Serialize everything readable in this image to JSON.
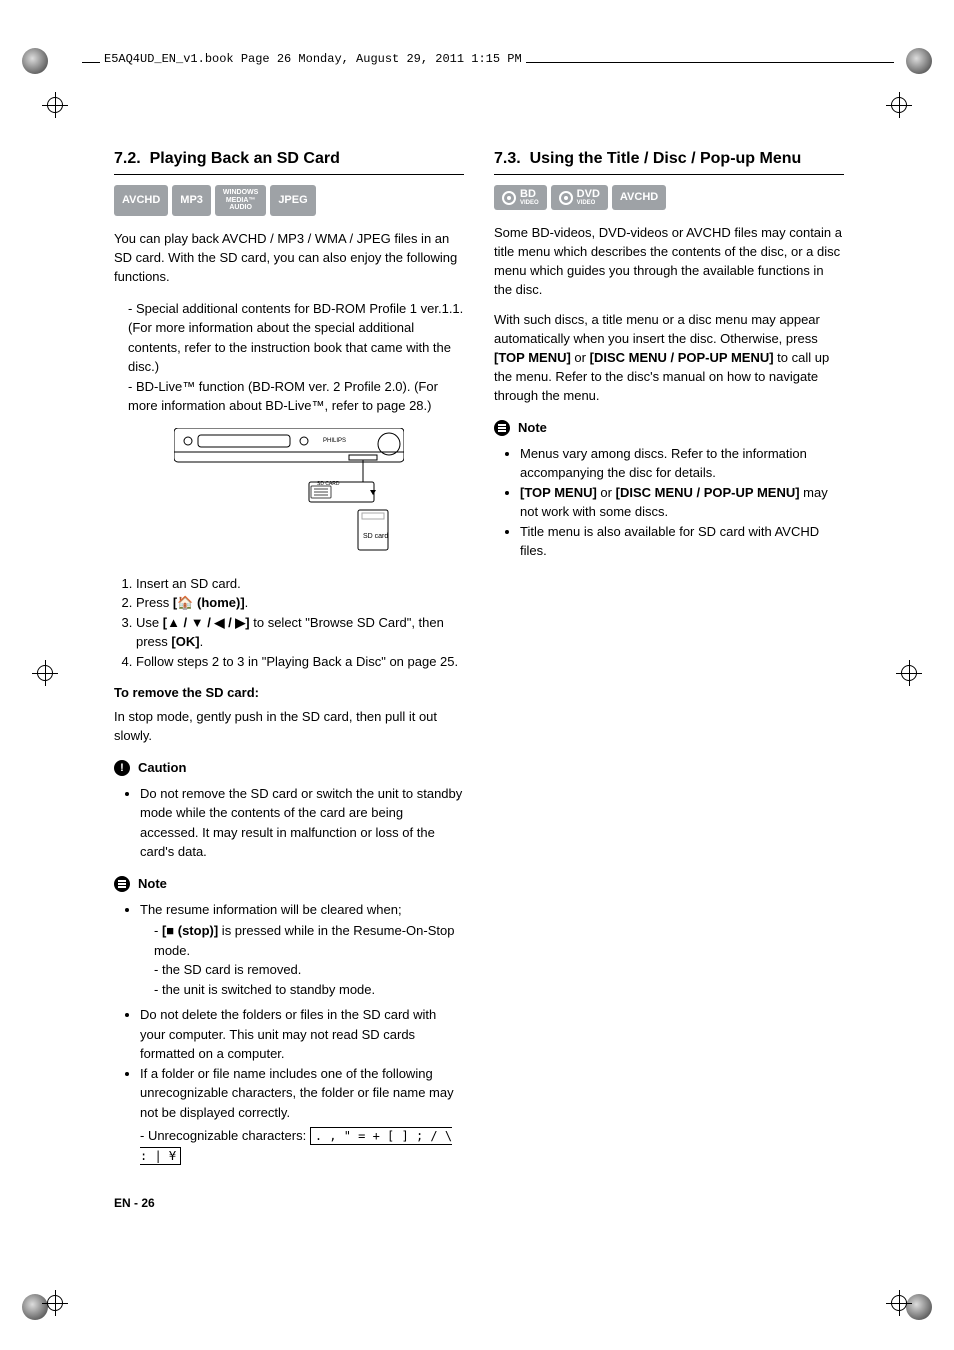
{
  "header_text": "E5AQ4UD_EN_v1.book  Page 26  Monday, August 29, 2011  1:15 PM",
  "left": {
    "section_number": "7.2.",
    "section_title": "Playing Back an  SD Card",
    "badges": [
      "AVCHD",
      "MP3",
      "WINDOWS MEDIA AUDIO",
      "JPEG"
    ],
    "intro": "You can play back AVCHD / MP3 / WMA / JPEG files in an SD card. With the SD card, you can also enjoy the following functions.",
    "dash_list": [
      "Special additional contents for BD-ROM Profile 1 ver.1.1. (For more information about the special additional contents, refer to the instruction book that came with the disc.)",
      "BD-Live™ function (BD-ROM ver. 2 Profile 2.0). (For more information about BD-Live™, refer to page 28.)"
    ],
    "figure_label": "SD card",
    "steps": [
      "Insert an SD card.",
      "Press [🏠 (home)].",
      "Use [▲ / ▼ / ◀ / ▶] to select \"Browse SD Card\", then press [OK].",
      "Follow steps 2 to 3 in \"Playing Back a Disc\" on page 25."
    ],
    "remove_title": "To remove the SD card:",
    "remove_text": "In stop mode, gently push in the SD card, then pull it out slowly.",
    "caution_title": "Caution",
    "caution_items": [
      "Do not remove the SD card or switch the unit to standby mode while the contents of the card are being accessed. It may result in malfunction or loss of the card's data."
    ],
    "note_title": "Note",
    "notes": [
      {
        "text": "The resume information will be cleared when;",
        "sub": [
          "[■ (stop)] is pressed while in the Resume-On-Stop mode.",
          "the SD card is removed.",
          "the unit is switched to standby mode."
        ]
      },
      {
        "text": "Do not delete the folders or files in the SD card with your computer. This unit may not read SD cards formatted on a computer."
      },
      {
        "text": "If a folder or file name includes one of the following unrecognizable characters, the folder or file name may not be displayed correctly.",
        "sub_plain": "- Unrecognizable characters: ",
        "char_box": ". , \" = + [ ] ; / \\ : | ¥"
      }
    ]
  },
  "right": {
    "section_number": "7.3.",
    "section_title": "Using the Title / Disc / Pop-up Menu",
    "badges": [
      "BD VIDEO",
      "DVD VIDEO",
      "AVCHD"
    ],
    "para1": "Some BD-videos, DVD-videos or AVCHD files may contain a title menu which describes the contents of the disc, or a disc menu which guides you through the available functions in the disc.",
    "para2_pre": "With such discs, a title menu or a disc menu may appear automatically when you insert the disc. Otherwise, press ",
    "para2_b1": "[TOP MENU]",
    "para2_mid": " or ",
    "para2_b2": "[DISC MENU / POP-UP MENU]",
    "para2_post": " to call up the menu. Refer to the disc's manual on how to navigate through the menu.",
    "note_title": "Note",
    "notes": [
      "Menus vary among discs. Refer to the information accompanying the disc for details.",
      "[TOP MENU] or [DISC MENU / POP-UP MENU] may not work with some discs.",
      "Title menu is also available for SD card with AVCHD files."
    ]
  },
  "footer_lang": "EN",
  "footer_sep": " - ",
  "footer_page": "26"
}
